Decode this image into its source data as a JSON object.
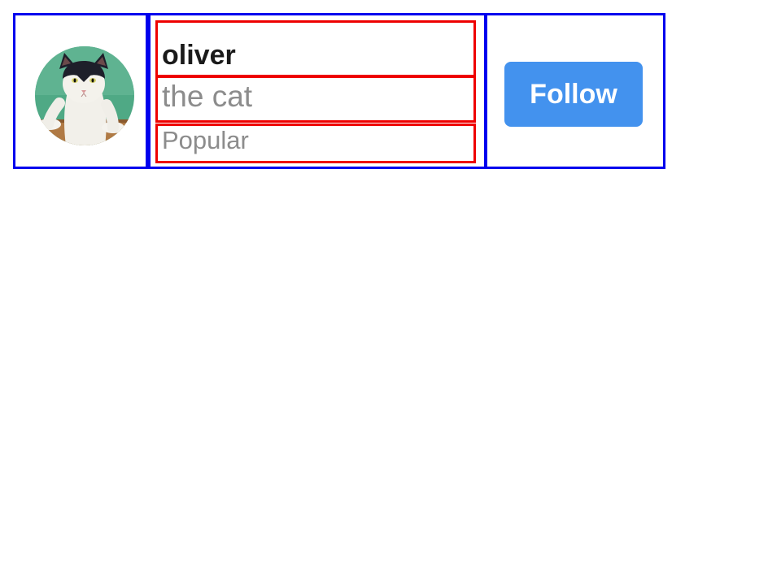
{
  "profile": {
    "name": "oliver",
    "handle": "the cat",
    "status": "Popular",
    "avatar_icon": "cat-photo"
  },
  "actions": {
    "follow_label": "Follow"
  },
  "colors": {
    "row_outline": "#0000ee",
    "line_outline": "#ee0000",
    "button_background": "#4392ee",
    "button_text": "#ffffff",
    "name_text": "#1a1a1a",
    "secondary_text": "#8c8c8c"
  }
}
